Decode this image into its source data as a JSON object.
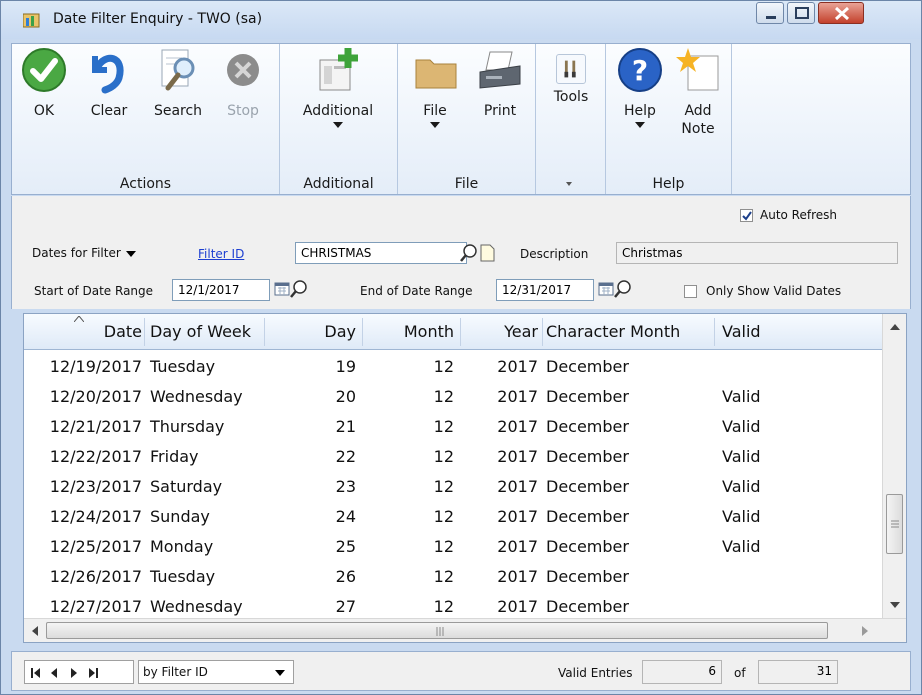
{
  "window": {
    "title": "Date Filter Enquiry  -  TWO (sa)"
  },
  "ribbon": {
    "groups": [
      {
        "label": "Actions",
        "buttons": [
          {
            "label": "OK",
            "icon": "ok-check-icon"
          },
          {
            "label": "Clear",
            "icon": "undo-arrow-icon"
          },
          {
            "label": "Search",
            "icon": "search-icon"
          },
          {
            "label": "Stop",
            "icon": "stop-icon",
            "disabled": true
          }
        ]
      },
      {
        "label": "Additional",
        "buttons": [
          {
            "label": "Additional",
            "icon": "window-add-icon"
          }
        ]
      },
      {
        "label": "File",
        "buttons": [
          {
            "label": "File",
            "icon": "folder-icon"
          },
          {
            "label": "Print",
            "icon": "printer-icon"
          }
        ]
      },
      {
        "label": "",
        "buttons": [
          {
            "label": "Tools",
            "icon": "tools-icon"
          }
        ]
      },
      {
        "label": "Help",
        "buttons": [
          {
            "label": "Help",
            "icon": "help-icon"
          },
          {
            "label": "Add Note",
            "icon": "note-icon"
          }
        ]
      }
    ]
  },
  "form": {
    "auto_refresh_label": "Auto Refresh",
    "auto_refresh_checked": true,
    "dates_for_filter": "Dates for Filter",
    "filter_id_label": "Filter ID",
    "filter_id_value": "CHRISTMAS",
    "description_label": "Description",
    "description_value": "Christmas",
    "start_label": "Start of Date Range",
    "start_value": "12/1/2017",
    "end_label": "End of Date Range",
    "end_value": "12/31/2017",
    "only_valid_label": "Only Show Valid Dates",
    "only_valid_checked": false
  },
  "grid": {
    "columns": [
      "Date",
      "Day of Week",
      "Day",
      "Month",
      "Year",
      "Character Month",
      "Valid"
    ],
    "rows": [
      [
        "12/19/2017",
        "Tuesday",
        "19",
        "12",
        "2017",
        "December",
        ""
      ],
      [
        "12/20/2017",
        "Wednesday",
        "20",
        "12",
        "2017",
        "December",
        "Valid"
      ],
      [
        "12/21/2017",
        "Thursday",
        "21",
        "12",
        "2017",
        "December",
        "Valid"
      ],
      [
        "12/22/2017",
        "Friday",
        "22",
        "12",
        "2017",
        "December",
        "Valid"
      ],
      [
        "12/23/2017",
        "Saturday",
        "23",
        "12",
        "2017",
        "December",
        "Valid"
      ],
      [
        "12/24/2017",
        "Sunday",
        "24",
        "12",
        "2017",
        "December",
        "Valid"
      ],
      [
        "12/25/2017",
        "Monday",
        "25",
        "12",
        "2017",
        "December",
        "Valid"
      ],
      [
        "12/26/2017",
        "Tuesday",
        "26",
        "12",
        "2017",
        "December",
        ""
      ],
      [
        "12/27/2017",
        "Wednesday",
        "27",
        "12",
        "2017",
        "December",
        ""
      ]
    ]
  },
  "status": {
    "sort_by": "by Filter ID",
    "valid_entries_label": "Valid Entries",
    "valid_entries": "6",
    "of_label": "of",
    "total": "31"
  }
}
